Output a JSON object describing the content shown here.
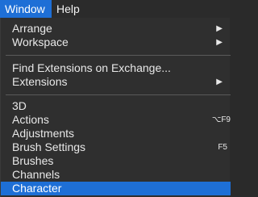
{
  "menubar": {
    "items": [
      {
        "label": "Window"
      },
      {
        "label": "Help"
      }
    ]
  },
  "menu": {
    "arrange": {
      "label": "Arrange",
      "arrow": "▶"
    },
    "workspace": {
      "label": "Workspace",
      "arrow": "▶"
    },
    "find_extensions": {
      "label": "Find Extensions on Exchange..."
    },
    "extensions": {
      "label": "Extensions",
      "arrow": "▶"
    },
    "item_3d": {
      "label": "3D"
    },
    "actions": {
      "label": "Actions",
      "shortcut": "⌥F9"
    },
    "adjustments": {
      "label": "Adjustments"
    },
    "brush_settings": {
      "label": "Brush Settings",
      "shortcut": "F5"
    },
    "brushes": {
      "label": "Brushes"
    },
    "channels": {
      "label": "Channels"
    },
    "character": {
      "label": "Character"
    }
  },
  "colors": {
    "highlight": "#1e6fd6",
    "menu_background": "#2f2f2f",
    "text": "#e8e8e8"
  }
}
